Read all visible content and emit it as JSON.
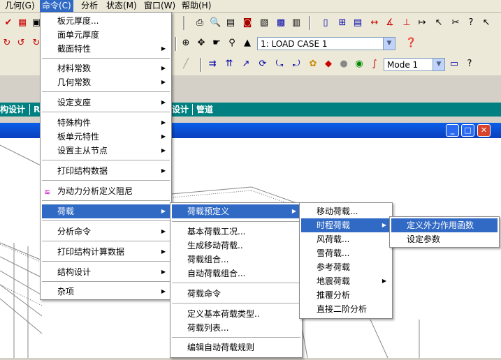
{
  "menubar": {
    "items": [
      "几何(G)",
      "命令(C)",
      "分析",
      "状态(M)",
      "窗口(W)",
      "帮助(H)"
    ]
  },
  "toolbar": {
    "load_case": "1: LOAD CASE 1",
    "mode": "Mode 1"
  },
  "tabs": [
    "构设计",
    "R",
    "设计",
    "管道"
  ],
  "main_menu": {
    "items": [
      "板元厚度...",
      "面单元厚度",
      "截面特性",
      "材料常数",
      "几何常数",
      "设定支座",
      "特殊构件",
      "板单元特性",
      "设置主从节点",
      "打印结构数据",
      "为动力分析定义阻尼",
      "荷载",
      "分析命令",
      "打印结构计算数据",
      "结构设计",
      "杂项"
    ]
  },
  "load_menu": {
    "items": [
      "荷载预定义",
      "基本荷载工况...",
      "生成移动荷载..",
      "荷载组合...",
      "自动荷载组合...",
      "荷载命令",
      "定义基本荷载类型..",
      "荷载列表...",
      "编辑自动荷载规则"
    ]
  },
  "predef_menu": {
    "items": [
      "移动荷载...",
      "时程荷载",
      "风荷载...",
      "雪荷载...",
      "参考荷载",
      "地震荷载",
      "推覆分析",
      "直接二阶分析"
    ]
  },
  "timehistory_menu": {
    "items": [
      "定义外力作用函数",
      "设定参数"
    ]
  },
  "colors": {
    "highlight": "#316ac5",
    "tabstrip": "#008080",
    "titlebar": "#0a5fe8"
  }
}
